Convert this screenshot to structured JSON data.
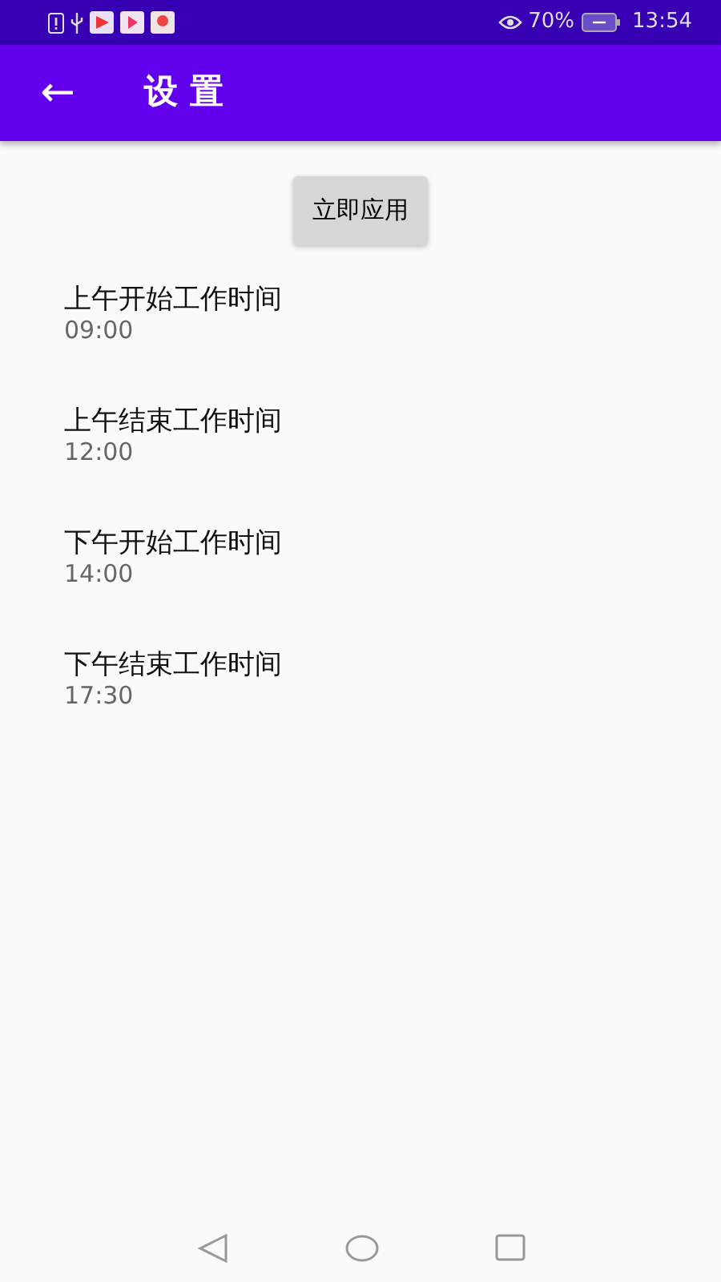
{
  "status_bar": {
    "battery_percent": "70%",
    "time": "13:54"
  },
  "app_bar": {
    "back": "←",
    "title": "设 置"
  },
  "apply_button": "立即应用",
  "settings": [
    {
      "label": "上午开始工作时间",
      "value": "09:00"
    },
    {
      "label": "上午结束工作时间",
      "value": "12:00"
    },
    {
      "label": "下午开始工作时间",
      "value": "14:00"
    },
    {
      "label": "下午结束工作时间",
      "value": "17:30"
    }
  ]
}
